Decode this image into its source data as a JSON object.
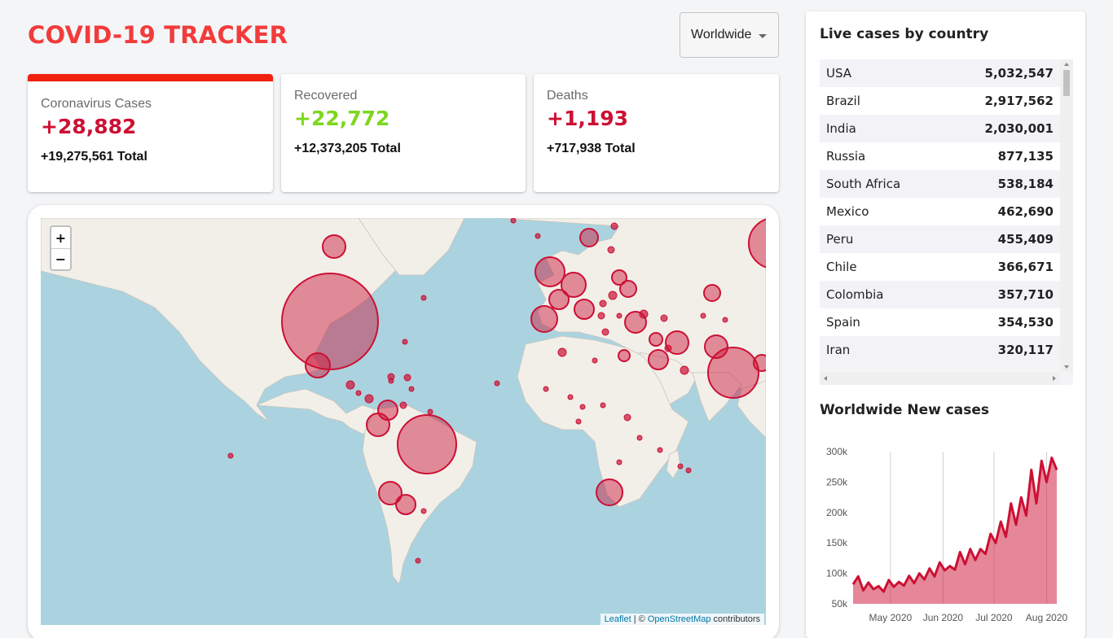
{
  "app": {
    "title": "COVID-19 TRACKER"
  },
  "region_select": {
    "value": "Worldwide"
  },
  "stats": {
    "cases": {
      "label": "Coronavirus Cases",
      "value": "+28,882",
      "total": "+19,275,561 Total",
      "accent": "#cc1034"
    },
    "recovered": {
      "label": "Recovered",
      "value": "+22,772",
      "total": "+12,373,205 Total",
      "accent": "#7dd71d"
    },
    "deaths": {
      "label": "Deaths",
      "value": "+1,193",
      "total": "+717,938 Total",
      "accent": "#cc1034"
    }
  },
  "map": {
    "zoom_in": "+",
    "zoom_out": "−",
    "attribution": {
      "leaflet": "Leaflet",
      "sep": " | © ",
      "osm": "OpenStreetMap",
      "suffix": " contributors"
    },
    "colors": {
      "water": "#aad3df",
      "land": "#f2efe9",
      "circle": "#cc1034"
    }
  },
  "live_cases": {
    "title": "Live cases by country",
    "rows": [
      {
        "country": "USA",
        "cases": "5,032,547"
      },
      {
        "country": "Brazil",
        "cases": "2,917,562"
      },
      {
        "country": "India",
        "cases": "2,030,001"
      },
      {
        "country": "Russia",
        "cases": "877,135"
      },
      {
        "country": "South Africa",
        "cases": "538,184"
      },
      {
        "country": "Mexico",
        "cases": "462,690"
      },
      {
        "country": "Peru",
        "cases": "455,409"
      },
      {
        "country": "Chile",
        "cases": "366,671"
      },
      {
        "country": "Colombia",
        "cases": "357,710"
      },
      {
        "country": "Spain",
        "cases": "354,530"
      },
      {
        "country": "Iran",
        "cases": "320,117"
      }
    ]
  },
  "new_cases": {
    "title": "Worldwide New cases",
    "chart_data": {
      "type": "area",
      "title": "Worldwide New cases",
      "xlabel": "",
      "ylabel": "",
      "x_tick_labels": [
        "May 2020",
        "Jun 2020",
        "Jul 2020",
        "Aug 2020"
      ],
      "y_tick_labels": [
        "300k",
        "250k",
        "200k",
        "150k",
        "100k",
        "50k"
      ],
      "ylim": [
        50000,
        300000
      ],
      "x": [
        "2020-04-09",
        "2020-04-12",
        "2020-04-15",
        "2020-04-18",
        "2020-04-21",
        "2020-04-24",
        "2020-04-27",
        "2020-04-30",
        "2020-05-03",
        "2020-05-06",
        "2020-05-09",
        "2020-05-12",
        "2020-05-15",
        "2020-05-18",
        "2020-05-21",
        "2020-05-24",
        "2020-05-27",
        "2020-05-30",
        "2020-06-02",
        "2020-06-05",
        "2020-06-08",
        "2020-06-11",
        "2020-06-14",
        "2020-06-17",
        "2020-06-20",
        "2020-06-23",
        "2020-06-26",
        "2020-06-29",
        "2020-07-02",
        "2020-07-05",
        "2020-07-08",
        "2020-07-11",
        "2020-07-14",
        "2020-07-17",
        "2020-07-20",
        "2020-07-23",
        "2020-07-26",
        "2020-07-29",
        "2020-08-01",
        "2020-08-04",
        "2020-08-07"
      ],
      "values": [
        82000,
        95000,
        72000,
        85000,
        74000,
        79000,
        70000,
        89000,
        78000,
        86000,
        80000,
        96000,
        84000,
        100000,
        90000,
        108000,
        95000,
        118000,
        105000,
        112000,
        106000,
        135000,
        115000,
        140000,
        122000,
        140000,
        132000,
        165000,
        150000,
        185000,
        160000,
        215000,
        180000,
        225000,
        195000,
        270000,
        215000,
        285000,
        250000,
        290000,
        270000
      ],
      "colors": {
        "line": "#cc1034",
        "fill": "rgba(204,16,52,0.5)"
      }
    }
  }
}
